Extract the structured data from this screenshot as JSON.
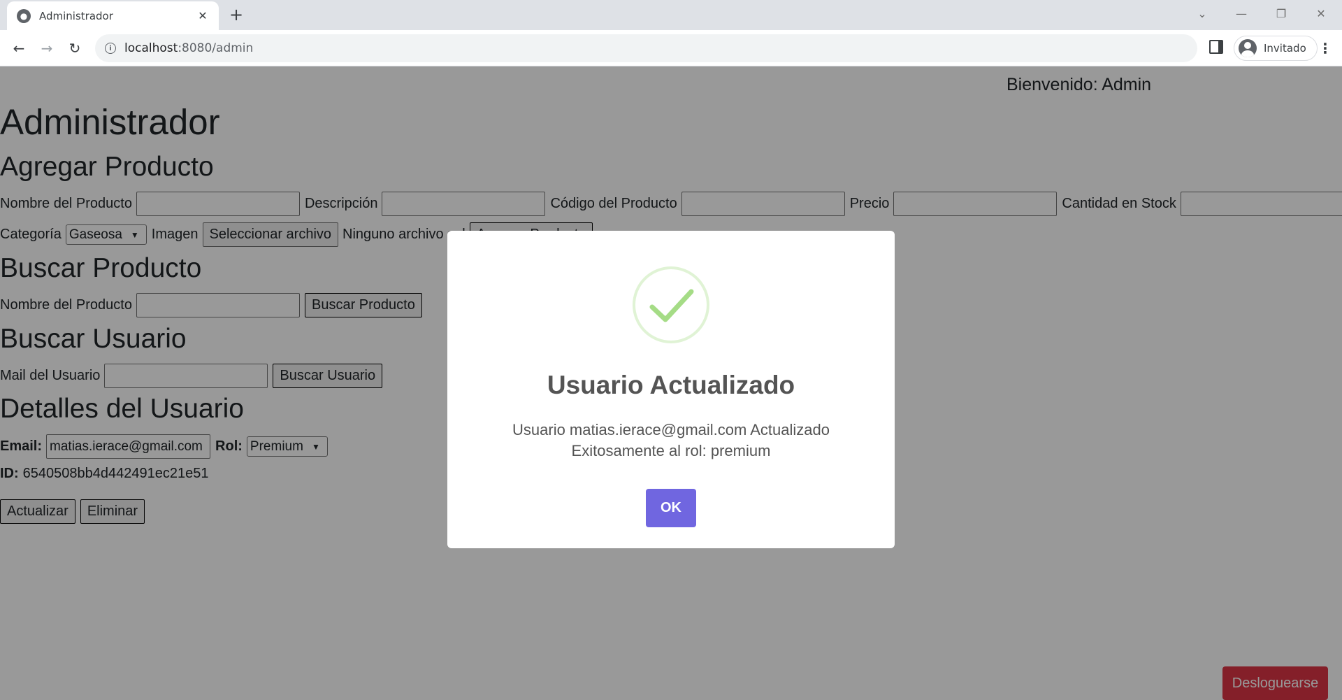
{
  "browser": {
    "tab_title": "Administrador",
    "url_host": "localhost",
    "url_rest": ":8080/admin",
    "profile_label": "Invitado"
  },
  "page": {
    "welcome": "Bienvenido: Admin",
    "title": "Administrador",
    "add_product": {
      "heading": "Agregar Producto",
      "name_label": "Nombre del Producto",
      "description_label": "Descripción",
      "code_label": "Código del Producto",
      "price_label": "Precio",
      "stock_label": "Cantidad en Stock",
      "category_label": "Categoría",
      "category_value": "Gaseosa",
      "image_label": "Imagen",
      "file_button": "Seleccionar archivo",
      "file_status": "Ninguno archivo sel",
      "add_button": "Agregar Producto"
    },
    "search_product": {
      "heading": "Buscar Producto",
      "name_label": "Nombre del Producto",
      "button": "Buscar Producto"
    },
    "search_user": {
      "heading": "Buscar Usuario",
      "mail_label": "Mail del Usuario",
      "button": "Buscar Usuario"
    },
    "user_details": {
      "heading": "Detalles del Usuario",
      "email_label": "Email:",
      "email_value": "matias.ierace@gmail.com",
      "role_label": "Rol:",
      "role_value": "Premium",
      "id_label": "ID:",
      "id_value": "6540508bb4d442491ec21e51",
      "update_button": "Actualizar",
      "delete_button": "Eliminar"
    },
    "logout_button": "Desloguearse"
  },
  "modal": {
    "title": "Usuario Actualizado",
    "line1": "Usuario matias.ierace@gmail.com Actualizado",
    "line2": "Exitosamente al rol: premium",
    "ok_button": "OK"
  },
  "colors": {
    "overlay": "#000000",
    "logout": "#dc3545",
    "ok": "#7066e0",
    "success": "#a5dc86"
  }
}
